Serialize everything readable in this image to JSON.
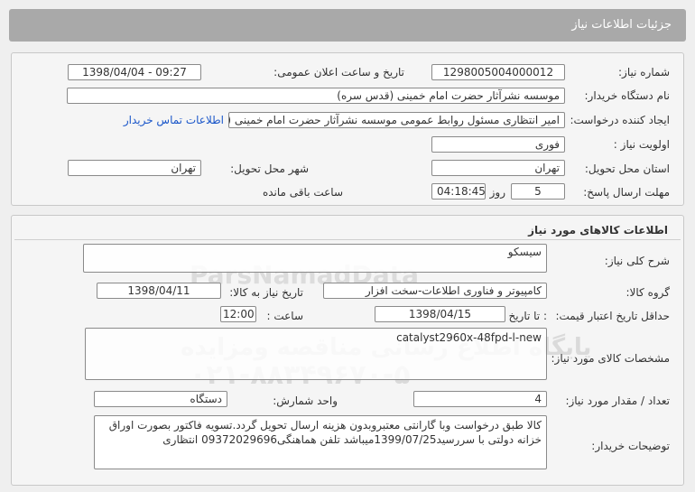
{
  "header": {
    "title": "جزئیات اطلاعات نیاز"
  },
  "section1": {
    "need_number": {
      "label": "شماره نیاز:",
      "value": "1298005004000012"
    },
    "announce_datetime": {
      "label": "تاریخ و ساعت اعلان عمومی:",
      "value": "1398/04/04 - 09:27"
    },
    "buyer_org": {
      "label": "نام دستگاه خریدار:",
      "value": "موسسه نشرآثار حضرت امام خمینی (قدس سره)"
    },
    "requester": {
      "label": "ایجاد کننده درخواست:",
      "value": "امیر انتظاری مسئول روابط عمومی موسسه نشرآثار حضرت امام خمینی (قدس سره)",
      "contact_link": "اطلاعات تماس خریدار"
    },
    "priority": {
      "label": "اولویت نیاز :",
      "value": "فوری"
    },
    "delivery_province": {
      "label": "استان محل تحویل:",
      "value": "تهران"
    },
    "delivery_city": {
      "label": "شهر محل تحویل:",
      "value": "تهران"
    },
    "reply_deadline": {
      "label": "مهلت ارسال پاسخ:",
      "days": "5",
      "days_label": "روز و",
      "time": "04:18:45",
      "remaining_label": "ساعت باقی مانده"
    }
  },
  "section2": {
    "title": "اطلاعات کالاهای مورد نیاز",
    "general_desc": {
      "label": "شرح کلی نیاز:",
      "value": "سیسکو"
    },
    "goods_group": {
      "label": "گروه کالا:",
      "value": "کامپیوتر و فناوری اطلاعات-سخت افزار"
    },
    "need_date": {
      "label": "تاریخ نیاز به کالا:",
      "value": "1398/04/11"
    },
    "price_validity": {
      "label": "حداقل تاریخ اعتبار قیمت:",
      "to_date_label": ": تا تاریخ",
      "date": "1398/04/15",
      "time_label": "ساعت :",
      "time": "12:00"
    },
    "specs": {
      "label": "مشخصات کالای مورد نیاز:",
      "value": "catalyst2960x-48fpd-l-new"
    },
    "quantity": {
      "label": "تعداد / مقدار مورد نیاز:",
      "value": "4"
    },
    "unit": {
      "label": "واحد شمارش:",
      "value": "دستگاه"
    },
    "buyer_notes": {
      "label": "توضیحات خریدار:",
      "value": "کالا طبق درخواست وبا گارانتی معتبروبدون هزینه ارسال تحویل گردد.تسویه فاکتور بصورت اوراق خزانه دولتی با سررسید1399/07/25میباشد تلفن هماهنگی09372029696 انتظاری"
    }
  },
  "watermark": {
    "brand": "ParsNamadData",
    "line1": "پایگاه اطلاع رسانی مناقصه ومزایده",
    "line2": "۰۲۱-۸۸۳۴۹۶۷۰-۵"
  }
}
